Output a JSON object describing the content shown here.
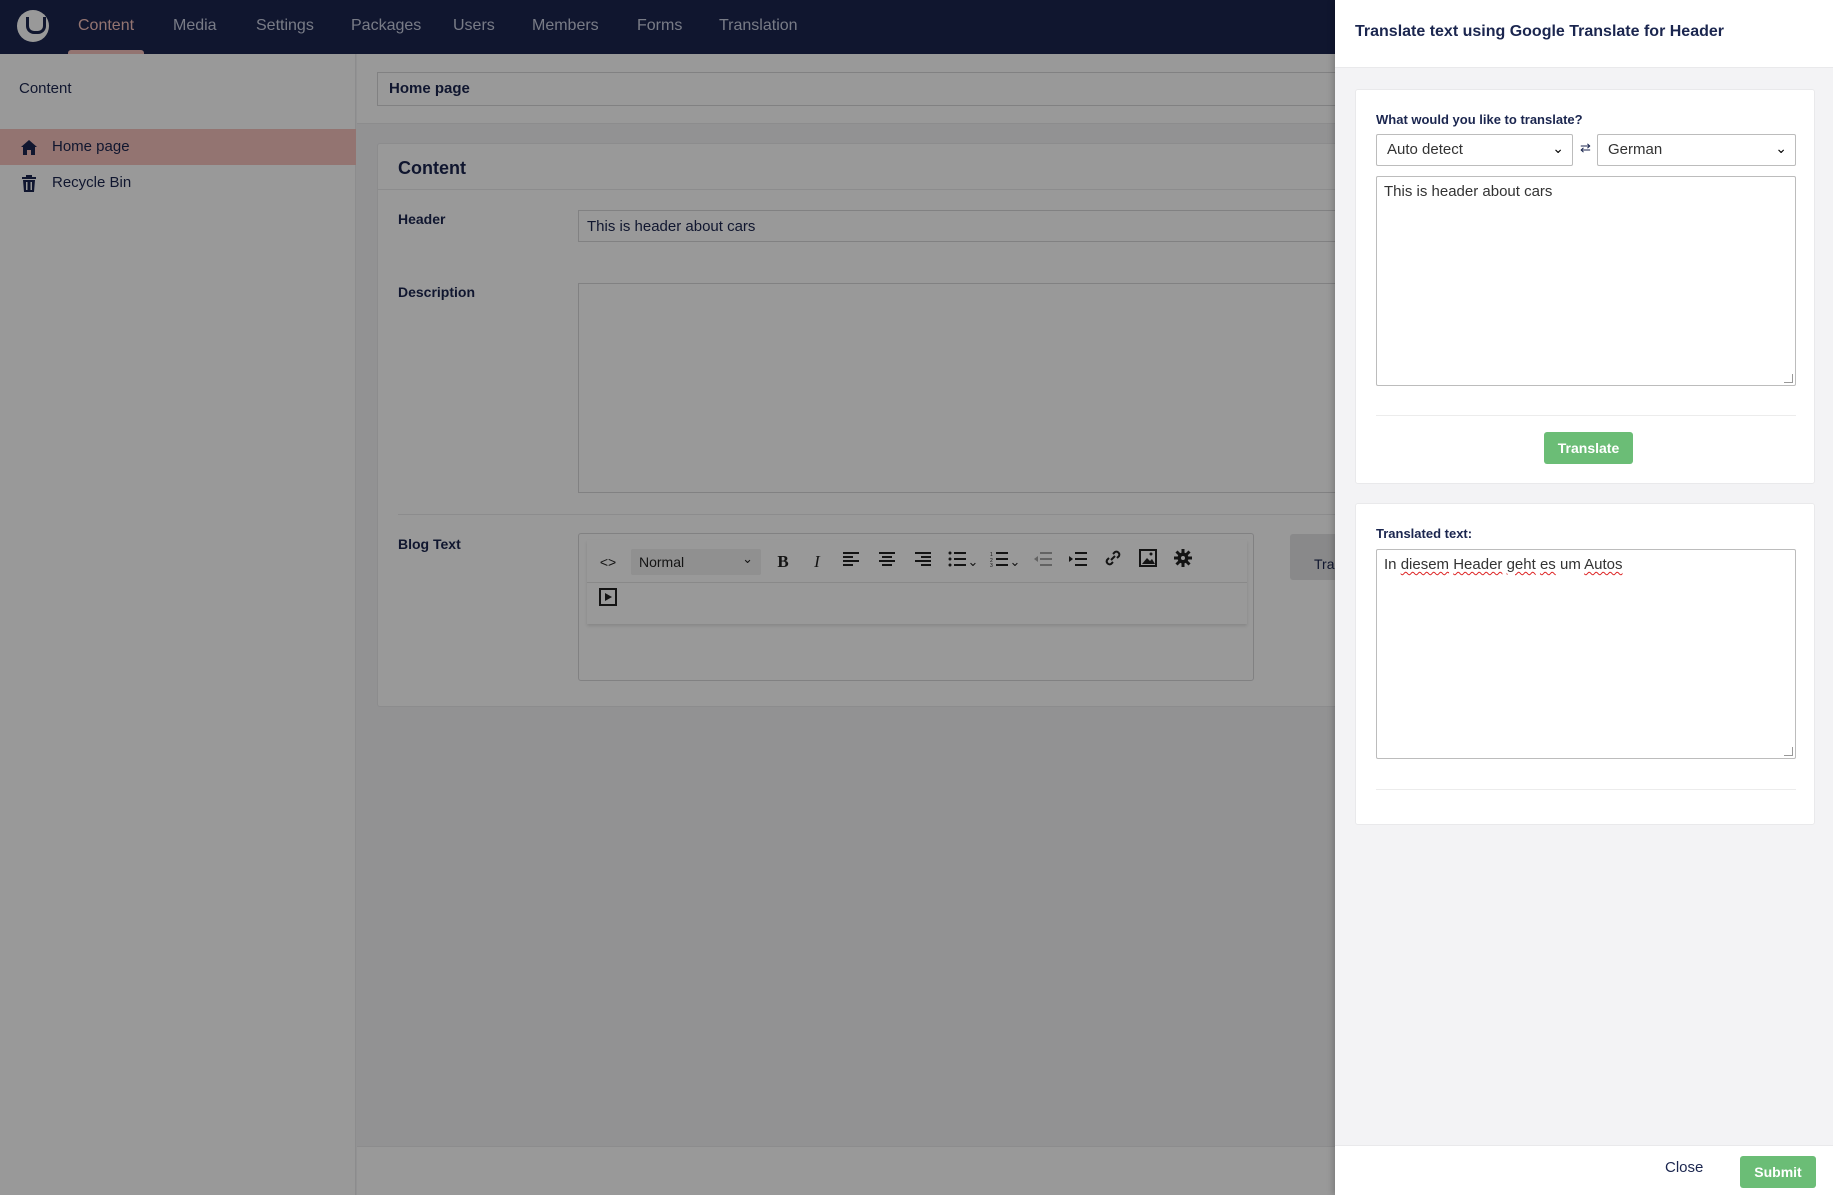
{
  "nav": {
    "items": [
      "Content",
      "Media",
      "Settings",
      "Packages",
      "Users",
      "Members",
      "Forms",
      "Translation"
    ],
    "active": "Content"
  },
  "tree": {
    "title": "Content",
    "items": [
      {
        "label": "Home page",
        "icon": "home-icon",
        "selected": true
      },
      {
        "label": "Recycle Bin",
        "icon": "trash-icon",
        "selected": false
      }
    ]
  },
  "editor": {
    "name": "Home page",
    "group_title": "Content",
    "header_label": "Header",
    "header_value": "This is header about cars",
    "description_label": "Description",
    "blog_label": "Blog Text",
    "format_value": "Normal",
    "side_translate_label": "Transla"
  },
  "dialog": {
    "title": "Translate text using Google Translate for Header",
    "question": "What would you like to translate?",
    "source_language": "Auto detect",
    "target_language": "German",
    "source_text": "This is header about cars",
    "translate_button": "Translate",
    "translated_label": "Translated text:",
    "translated_words": [
      "In",
      "diesem",
      "Header",
      "geht",
      "es",
      "um",
      "Autos"
    ],
    "close_button": "Close",
    "submit_button": "Submit"
  },
  "colors": {
    "nav_bg": "#1b264f",
    "accent_pink": "#f5c1bc",
    "green": "#6bbd76"
  }
}
